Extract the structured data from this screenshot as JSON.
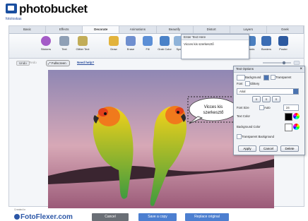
{
  "brand": {
    "logo": "photobucket",
    "user": "fotoloskas"
  },
  "tabs": [
    "Basic",
    "Effects",
    "Decorate",
    "Animations",
    "Beautify",
    "Distort",
    "Layers",
    "Geek"
  ],
  "active_tab": 2,
  "tools": [
    {
      "label": "Stickers",
      "icon": "sticker-icon",
      "color": "#a45bc7"
    },
    {
      "label": "Text",
      "icon": "text-icon",
      "color": "#8fa0b6"
    },
    {
      "label": "Glitter Text",
      "icon": "glitter-text-icon",
      "color": "#c2ad58"
    },
    {
      "label": "Draw",
      "icon": "pencil-icon",
      "color": "#e2b33c"
    },
    {
      "label": "Erase",
      "icon": "eraser-icon",
      "color": "#6f8fcf"
    },
    {
      "label": "Fill",
      "icon": "bucket-icon",
      "color": "#5c8fd6"
    },
    {
      "label": "Grab Color",
      "icon": "eyedropper-icon",
      "color": "#4a82c8"
    },
    {
      "label": "Spe",
      "icon": "speech-icon",
      "color": "#8fb3d9"
    }
  ],
  "right_tools": [
    {
      "label": "Cards",
      "icon": "card-icon",
      "color": "#4b7fbf"
    },
    {
      "label": "Borders",
      "icon": "border-icon",
      "color": "#3b6db4"
    },
    {
      "label": "Poster",
      "icon": "poster-icon",
      "color": "#2d5aa0"
    }
  ],
  "subbar": {
    "undo": "Undo",
    "redo": "Redo",
    "fullscreen": "Fullscreen",
    "help": "Need help?"
  },
  "text_popup": {
    "header": "Enter Text Here",
    "value": "Vicces kis szerkesztő"
  },
  "speech_text": "Vicces kis szerkesztő",
  "text_options": {
    "title": "Text Options",
    "background_label": "Background",
    "transparent": "Transparent",
    "font_label": "Font",
    "glittery": "Glittery",
    "font_value": "Arial",
    "font_size_label": "Font Size",
    "auto": "Auto",
    "font_size": "24",
    "text_color": "Text Color",
    "text_color_value": "#000000",
    "bg_color": "Background Color",
    "bg_color_value": "#ffffff",
    "transparent_bg": "Transparent Background",
    "apply": "Apply",
    "cancel": "Cancel",
    "delete": "Delete"
  },
  "footer": {
    "created_in": "Created in",
    "logo": "FotoFlexer.com",
    "cancel": "Cancel",
    "save_copy": "Save a copy",
    "replace": "Replace original"
  }
}
